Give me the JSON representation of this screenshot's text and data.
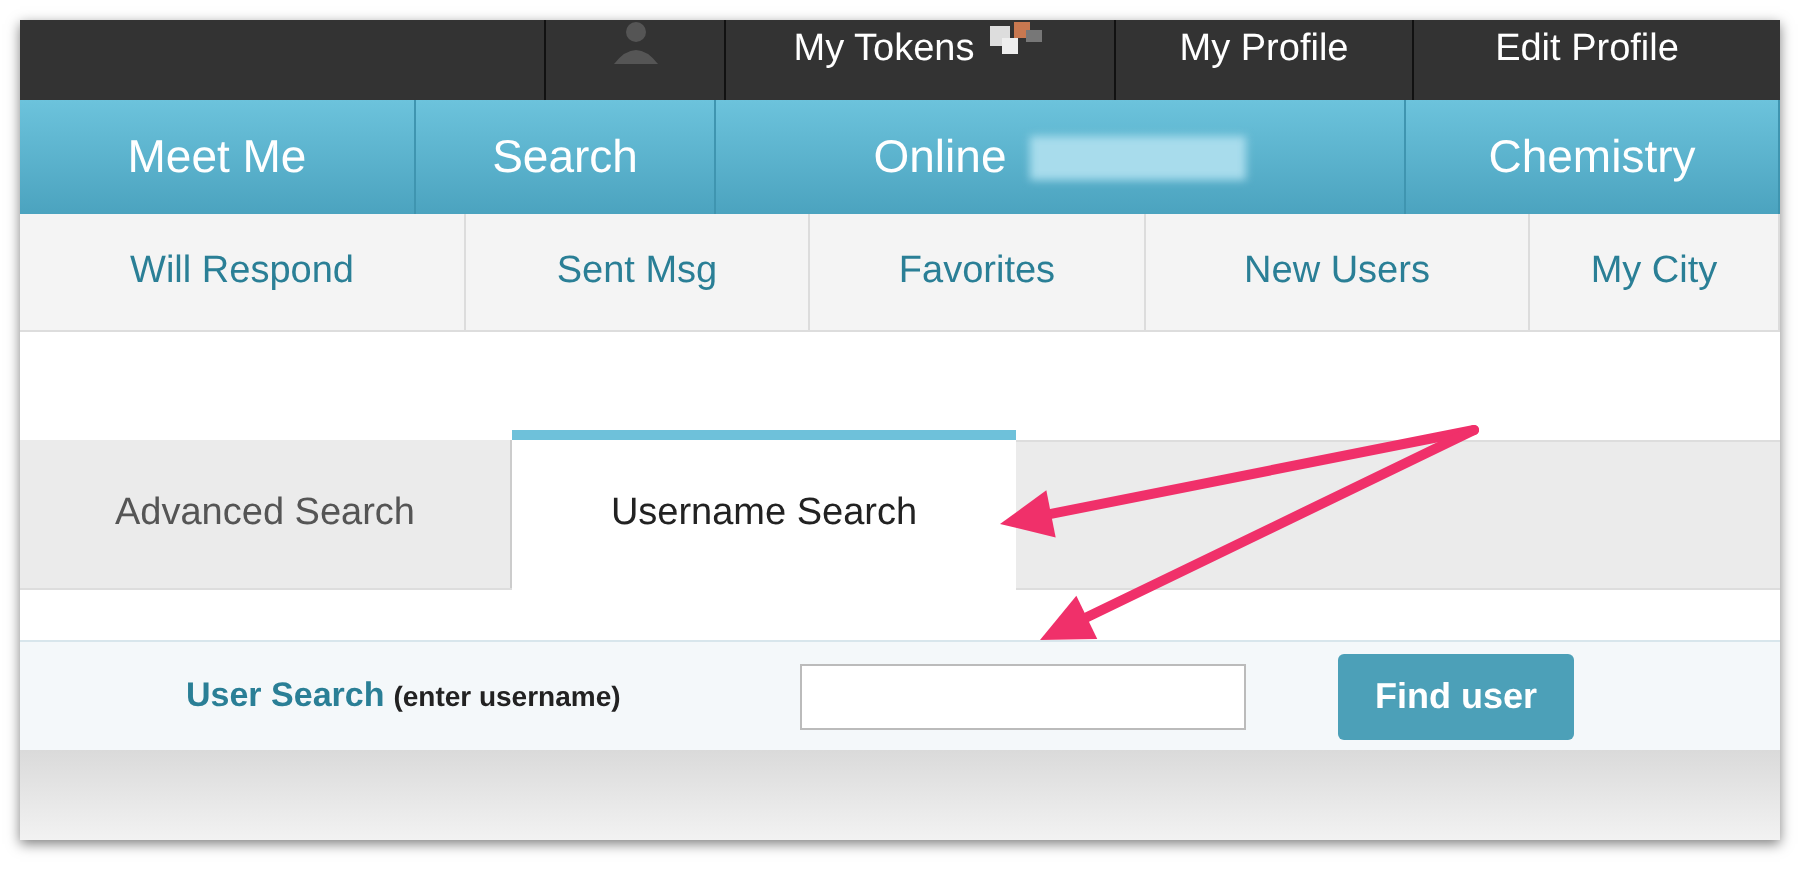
{
  "top_bar": {
    "items": [
      {
        "kind": "avatar"
      },
      {
        "kind": "tokens",
        "label": "My Tokens"
      },
      {
        "kind": "link",
        "label": "My Profile"
      },
      {
        "kind": "link",
        "label": "Edit Profile"
      }
    ]
  },
  "main_nav": [
    {
      "label": "Meet Me"
    },
    {
      "label": "Search"
    },
    {
      "label": "Online",
      "redacted": true
    },
    {
      "label": "Chemistry"
    }
  ],
  "sub_nav": [
    "Will Respond",
    "Sent Msg",
    "Favorites",
    "New Users",
    "My City"
  ],
  "tabs": [
    {
      "label": "Advanced Search",
      "selected": false
    },
    {
      "label": "Username Search",
      "selected": true
    }
  ],
  "user_search": {
    "label": "User Search",
    "hint": "(enter username)",
    "button": "Find user"
  }
}
